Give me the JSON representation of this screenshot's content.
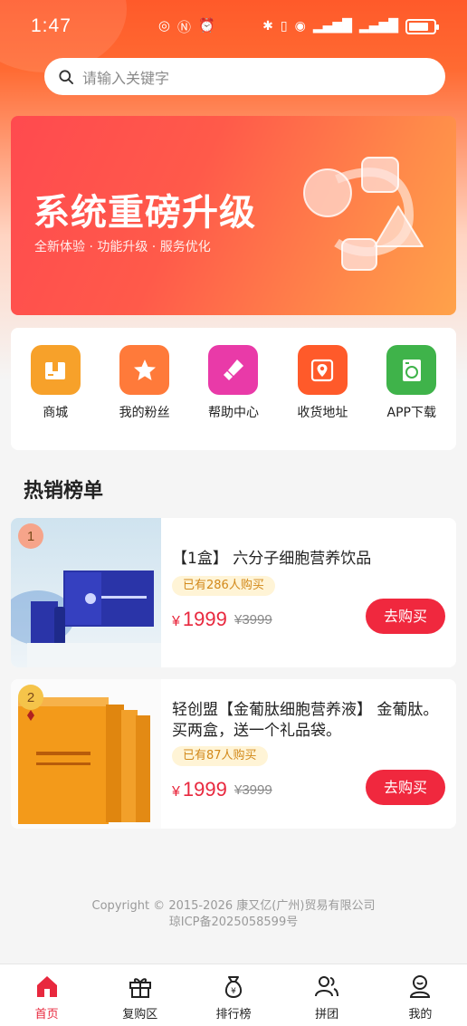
{
  "colors": {
    "accent": "#e8283e",
    "header_orange": "#ff5a2a",
    "sold_badge_bg": "#fff4d6",
    "sold_badge_text": "#d2891a"
  },
  "status_bar": {
    "time": "1:47",
    "icons": [
      "nfc-icon",
      "alarm-icon",
      "bluetooth-icon",
      "vibrate-icon",
      "hotspot-icon",
      "signal-icon",
      "signal-icon",
      "battery-icon"
    ]
  },
  "search": {
    "placeholder": "请输入关键字"
  },
  "banner": {
    "title": "系统重磅升级",
    "subtitle": "全新体验 · 功能升级 · 服务优化"
  },
  "menu": [
    {
      "label": "商城",
      "icon": "shop-box-icon",
      "color": "#f7a12a"
    },
    {
      "label": "我的粉丝",
      "icon": "star-icon",
      "color": "#ff7a3a"
    },
    {
      "label": "帮助中心",
      "icon": "lipstick-icon",
      "color": "#e93aa8"
    },
    {
      "label": "收货地址",
      "icon": "map-pin-icon",
      "color": "#ff5a2a"
    },
    {
      "label": "APP下载",
      "icon": "washer-icon",
      "color": "#3fb34a"
    }
  ],
  "section": {
    "title": "热销榜单"
  },
  "products": [
    {
      "rank": "1",
      "name": "【1盒】 六分子细胞营养饮品",
      "sold": "已有286人购买",
      "price": "1999",
      "currency": "¥",
      "original_price": "¥3999",
      "button": "去购买"
    },
    {
      "rank": "2",
      "name": "轻创盟【金葡肽细胞营养液】 金葡肽。买两盒，送一个礼品袋。",
      "sold": "已有87人购买",
      "price": "1999",
      "currency": "¥",
      "original_price": "¥3999",
      "button": "去购买"
    }
  ],
  "footer": {
    "copyright": "Copyright © 2015-2026 康又亿(广州)贸易有限公司",
    "icp": "琼ICP备2025058599号"
  },
  "tabbar": [
    {
      "label": "首页",
      "icon": "home-icon",
      "active": true
    },
    {
      "label": "复购区",
      "icon": "gift-icon",
      "active": false
    },
    {
      "label": "排行榜",
      "icon": "money-bag-icon",
      "active": false
    },
    {
      "label": "拼团",
      "icon": "group-icon",
      "active": false
    },
    {
      "label": "我的",
      "icon": "user-icon",
      "active": false
    }
  ]
}
